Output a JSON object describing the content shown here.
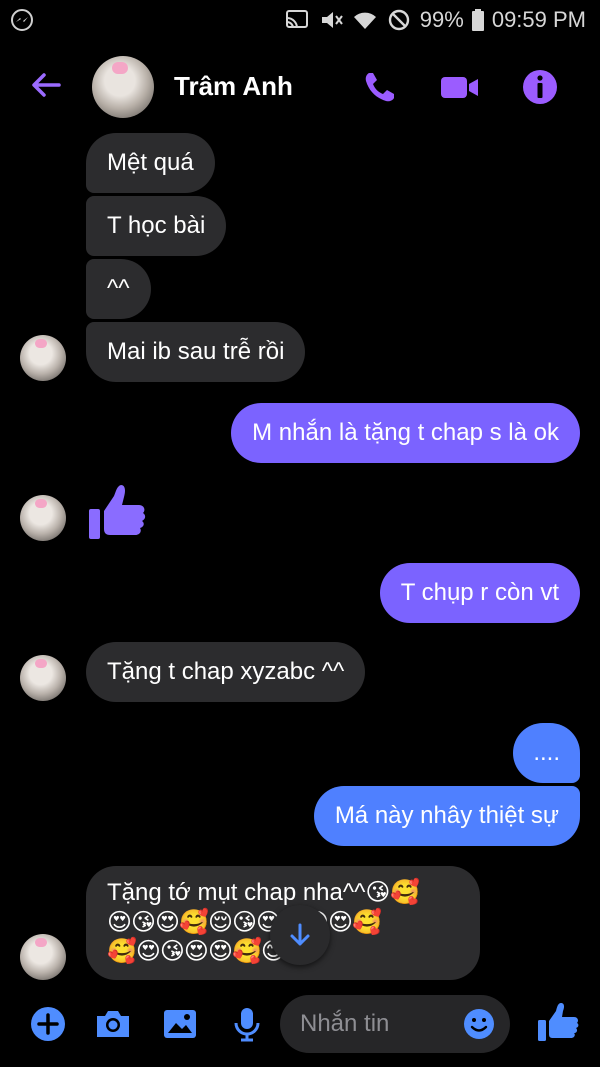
{
  "statusbar": {
    "battery": "99%",
    "time": "09:59 PM"
  },
  "header": {
    "contact_name": "Trâm Anh",
    "icons": [
      "back-arrow-icon",
      "phone-icon",
      "video-camera-icon",
      "info-icon"
    ]
  },
  "messages": [
    {
      "side": "in",
      "text": "Mệt quá"
    },
    {
      "side": "in",
      "text": "T học bài"
    },
    {
      "side": "in",
      "text": "^^"
    },
    {
      "side": "in",
      "text": "Mai ib sau trễ rồi"
    },
    {
      "side": "out",
      "text": "M nhắn là tặng t chap s là ok"
    },
    {
      "side": "in",
      "type": "like",
      "icon": "thumbs-up-icon"
    },
    {
      "side": "out",
      "text": "T chụp r còn vt"
    },
    {
      "side": "in",
      "text": "Tặng t chap xyzabc ^^"
    },
    {
      "side": "out",
      "text": "...."
    },
    {
      "side": "out",
      "text": "Má này nhây thiệt sự"
    },
    {
      "side": "in",
      "text": "Tặng tớ mụt chap nha^^😘🥰",
      "emoji_line_1": "😍😘😍🥰😌😘😍😍😘😍🥰",
      "emoji_line_2": "🥰😍😘😍😍🥰😊"
    }
  ],
  "composer": {
    "placeholder": "Nhắn tin",
    "icons": [
      "plus-icon",
      "camera-icon",
      "image-icon",
      "microphone-icon",
      "emoji-icon",
      "thumbs-up-icon"
    ]
  },
  "colors": {
    "accent": "#7b63ff",
    "outgoing_blue": "#4f80ff",
    "incoming_bubble": "#2c2c2e",
    "composer_icon": "#4f8dff"
  }
}
